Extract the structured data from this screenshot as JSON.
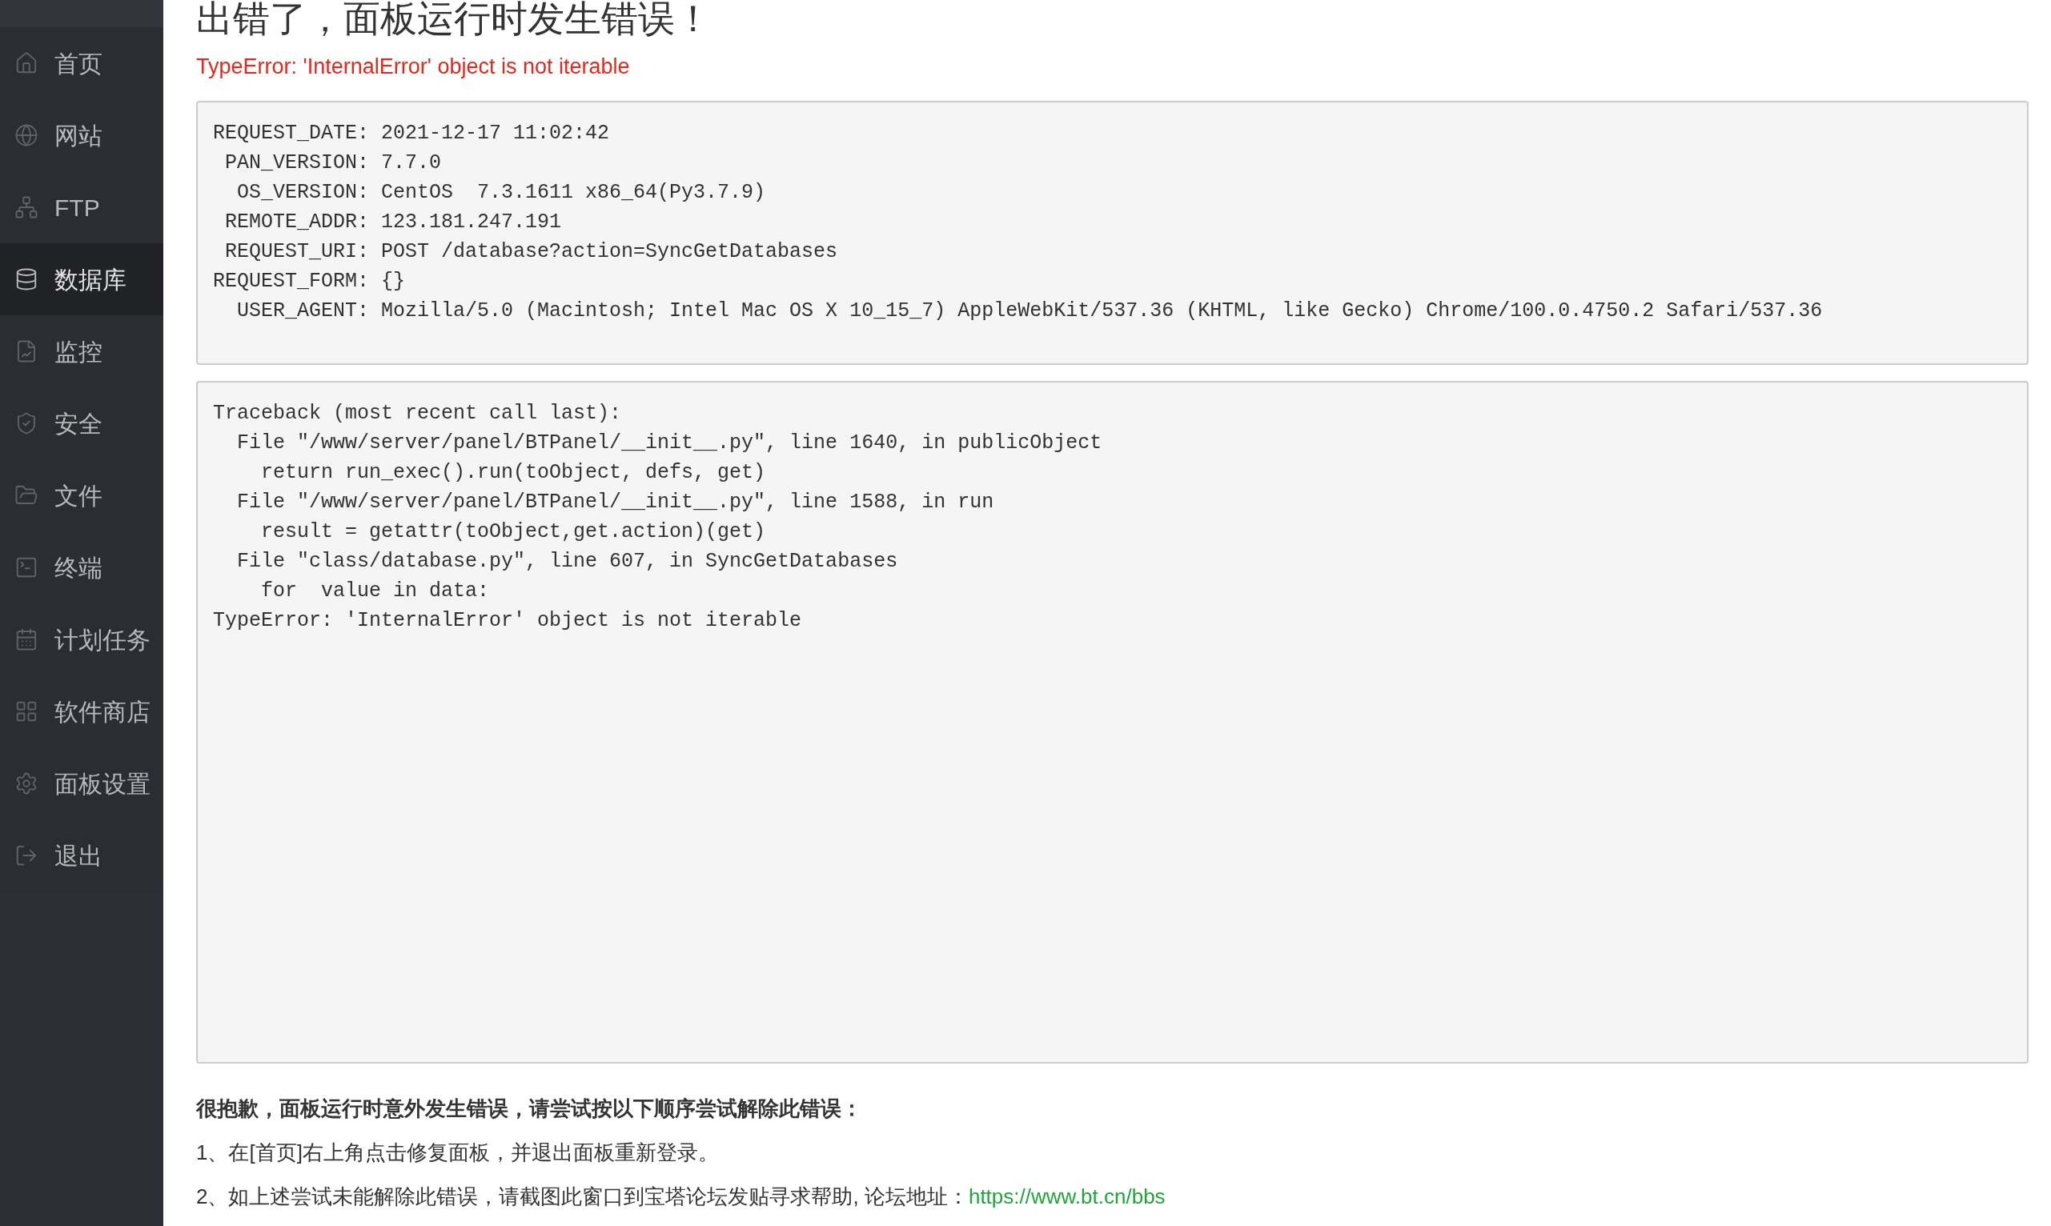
{
  "sidebar": {
    "items": [
      {
        "label": "首页",
        "selected": false
      },
      {
        "label": "网站",
        "selected": false
      },
      {
        "label": "FTP",
        "selected": false
      },
      {
        "label": "数据库",
        "selected": true
      },
      {
        "label": "监控",
        "selected": false
      },
      {
        "label": "安全",
        "selected": false
      },
      {
        "label": "文件",
        "selected": false
      },
      {
        "label": "终端",
        "selected": false
      },
      {
        "label": "计划任务",
        "selected": false
      },
      {
        "label": "软件商店",
        "selected": false
      },
      {
        "label": "面板设置",
        "selected": false
      },
      {
        "label": "退出",
        "selected": false
      }
    ]
  },
  "heading": "出错了，面板运行时发生错误！",
  "error_message": "TypeError: 'InternalError' object is not iterable",
  "request_info": [
    "REQUEST_DATE: 2021-12-17 11:02:42",
    " PAN_VERSION: 7.7.0",
    "  OS_VERSION: CentOS  7.3.1611 x86_64(Py3.7.9)",
    " REMOTE_ADDR: 123.181.247.191",
    " REQUEST_URI: POST /database?action=SyncGetDatabases",
    "REQUEST_FORM: {}",
    "  USER_AGENT: Mozilla/5.0 (Macintosh; Intel Mac OS X 10_15_7) AppleWebKit/537.36 (KHTML, like Gecko) Chrome/100.0.4750.2 Safari/537.36"
  ],
  "traceback": [
    "Traceback (most recent call last):",
    "  File \"/www/server/panel/BTPanel/__init__.py\", line 1640, in publicObject",
    "    return run_exec().run(toObject, defs, get)",
    "  File \"/www/server/panel/BTPanel/__init__.py\", line 1588, in run",
    "    result = getattr(toObject,get.action)(get)",
    "  File \"class/database.py\", line 607, in SyncGetDatabases",
    "    for  value in data:",
    "TypeError: 'InternalError' object is not iterable"
  ],
  "help": {
    "title": "很抱歉，面板运行时意外发生错误，请尝试按以下顺序尝试解除此错误：",
    "steps": [
      "1、在[首页]右上角点击修复面板，并退出面板重新登录。",
      "2、如上述尝试未能解除此错误，请截图此窗口到宝塔论坛发贴寻求帮助, 论坛地址："
    ],
    "link": "https://www.bt.cn/bbs"
  }
}
